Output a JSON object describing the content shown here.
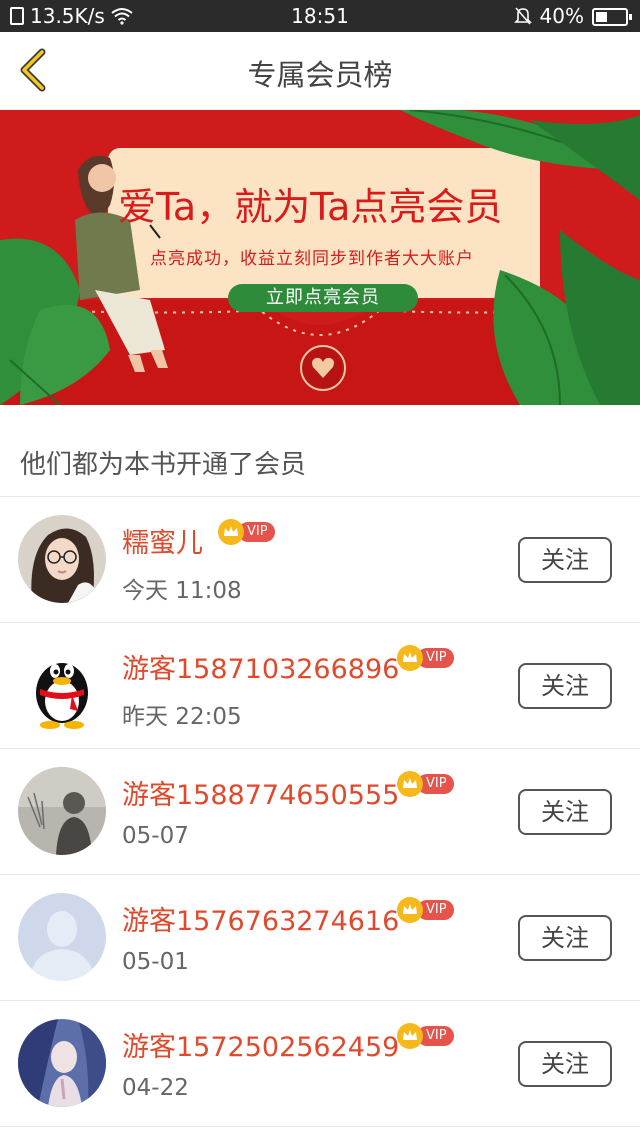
{
  "status_bar": {
    "net_speed": "13.5K/s",
    "time": "18:51",
    "battery": "40%",
    "battery_level": 0.4
  },
  "header": {
    "title": "专属会员榜",
    "back_icon": "chevron-left-icon"
  },
  "banner": {
    "title": "爱Ta，就为Ta点亮会员",
    "subtitle": "点亮成功，收益立刻同步到作者大大账户",
    "button_label": "立即点亮会员",
    "colors": {
      "background": "#cf1b1b",
      "card": "#fbe3c4",
      "button": "#2e8b3a",
      "leaf": "#2f8f3a"
    }
  },
  "section": {
    "title": "他们都为本书开通了会员"
  },
  "members": [
    {
      "name": "糯蜜儿",
      "time": "今天 11:08",
      "vip": "VIP",
      "follow_label": "关注",
      "avatar": "girl-glasses"
    },
    {
      "name": "游客1587103266896",
      "time": "昨天 22:05",
      "vip": "VIP",
      "follow_label": "关注",
      "avatar": "qq-penguin"
    },
    {
      "name": "游客1588774650555",
      "time": "05-07",
      "vip": "VIP",
      "follow_label": "关注",
      "avatar": "gray-photo"
    },
    {
      "name": "游客1576763274616",
      "time": "05-01",
      "vip": "VIP",
      "follow_label": "关注",
      "avatar": "default-silhouette"
    },
    {
      "name": "游客1572502562459",
      "time": "04-22",
      "vip": "VIP",
      "follow_label": "关注",
      "avatar": "blue-illustration"
    }
  ],
  "colors": {
    "name": "#e04a2c",
    "vip_pill": "#e5534b",
    "vip_crown": "#f6b91c"
  }
}
